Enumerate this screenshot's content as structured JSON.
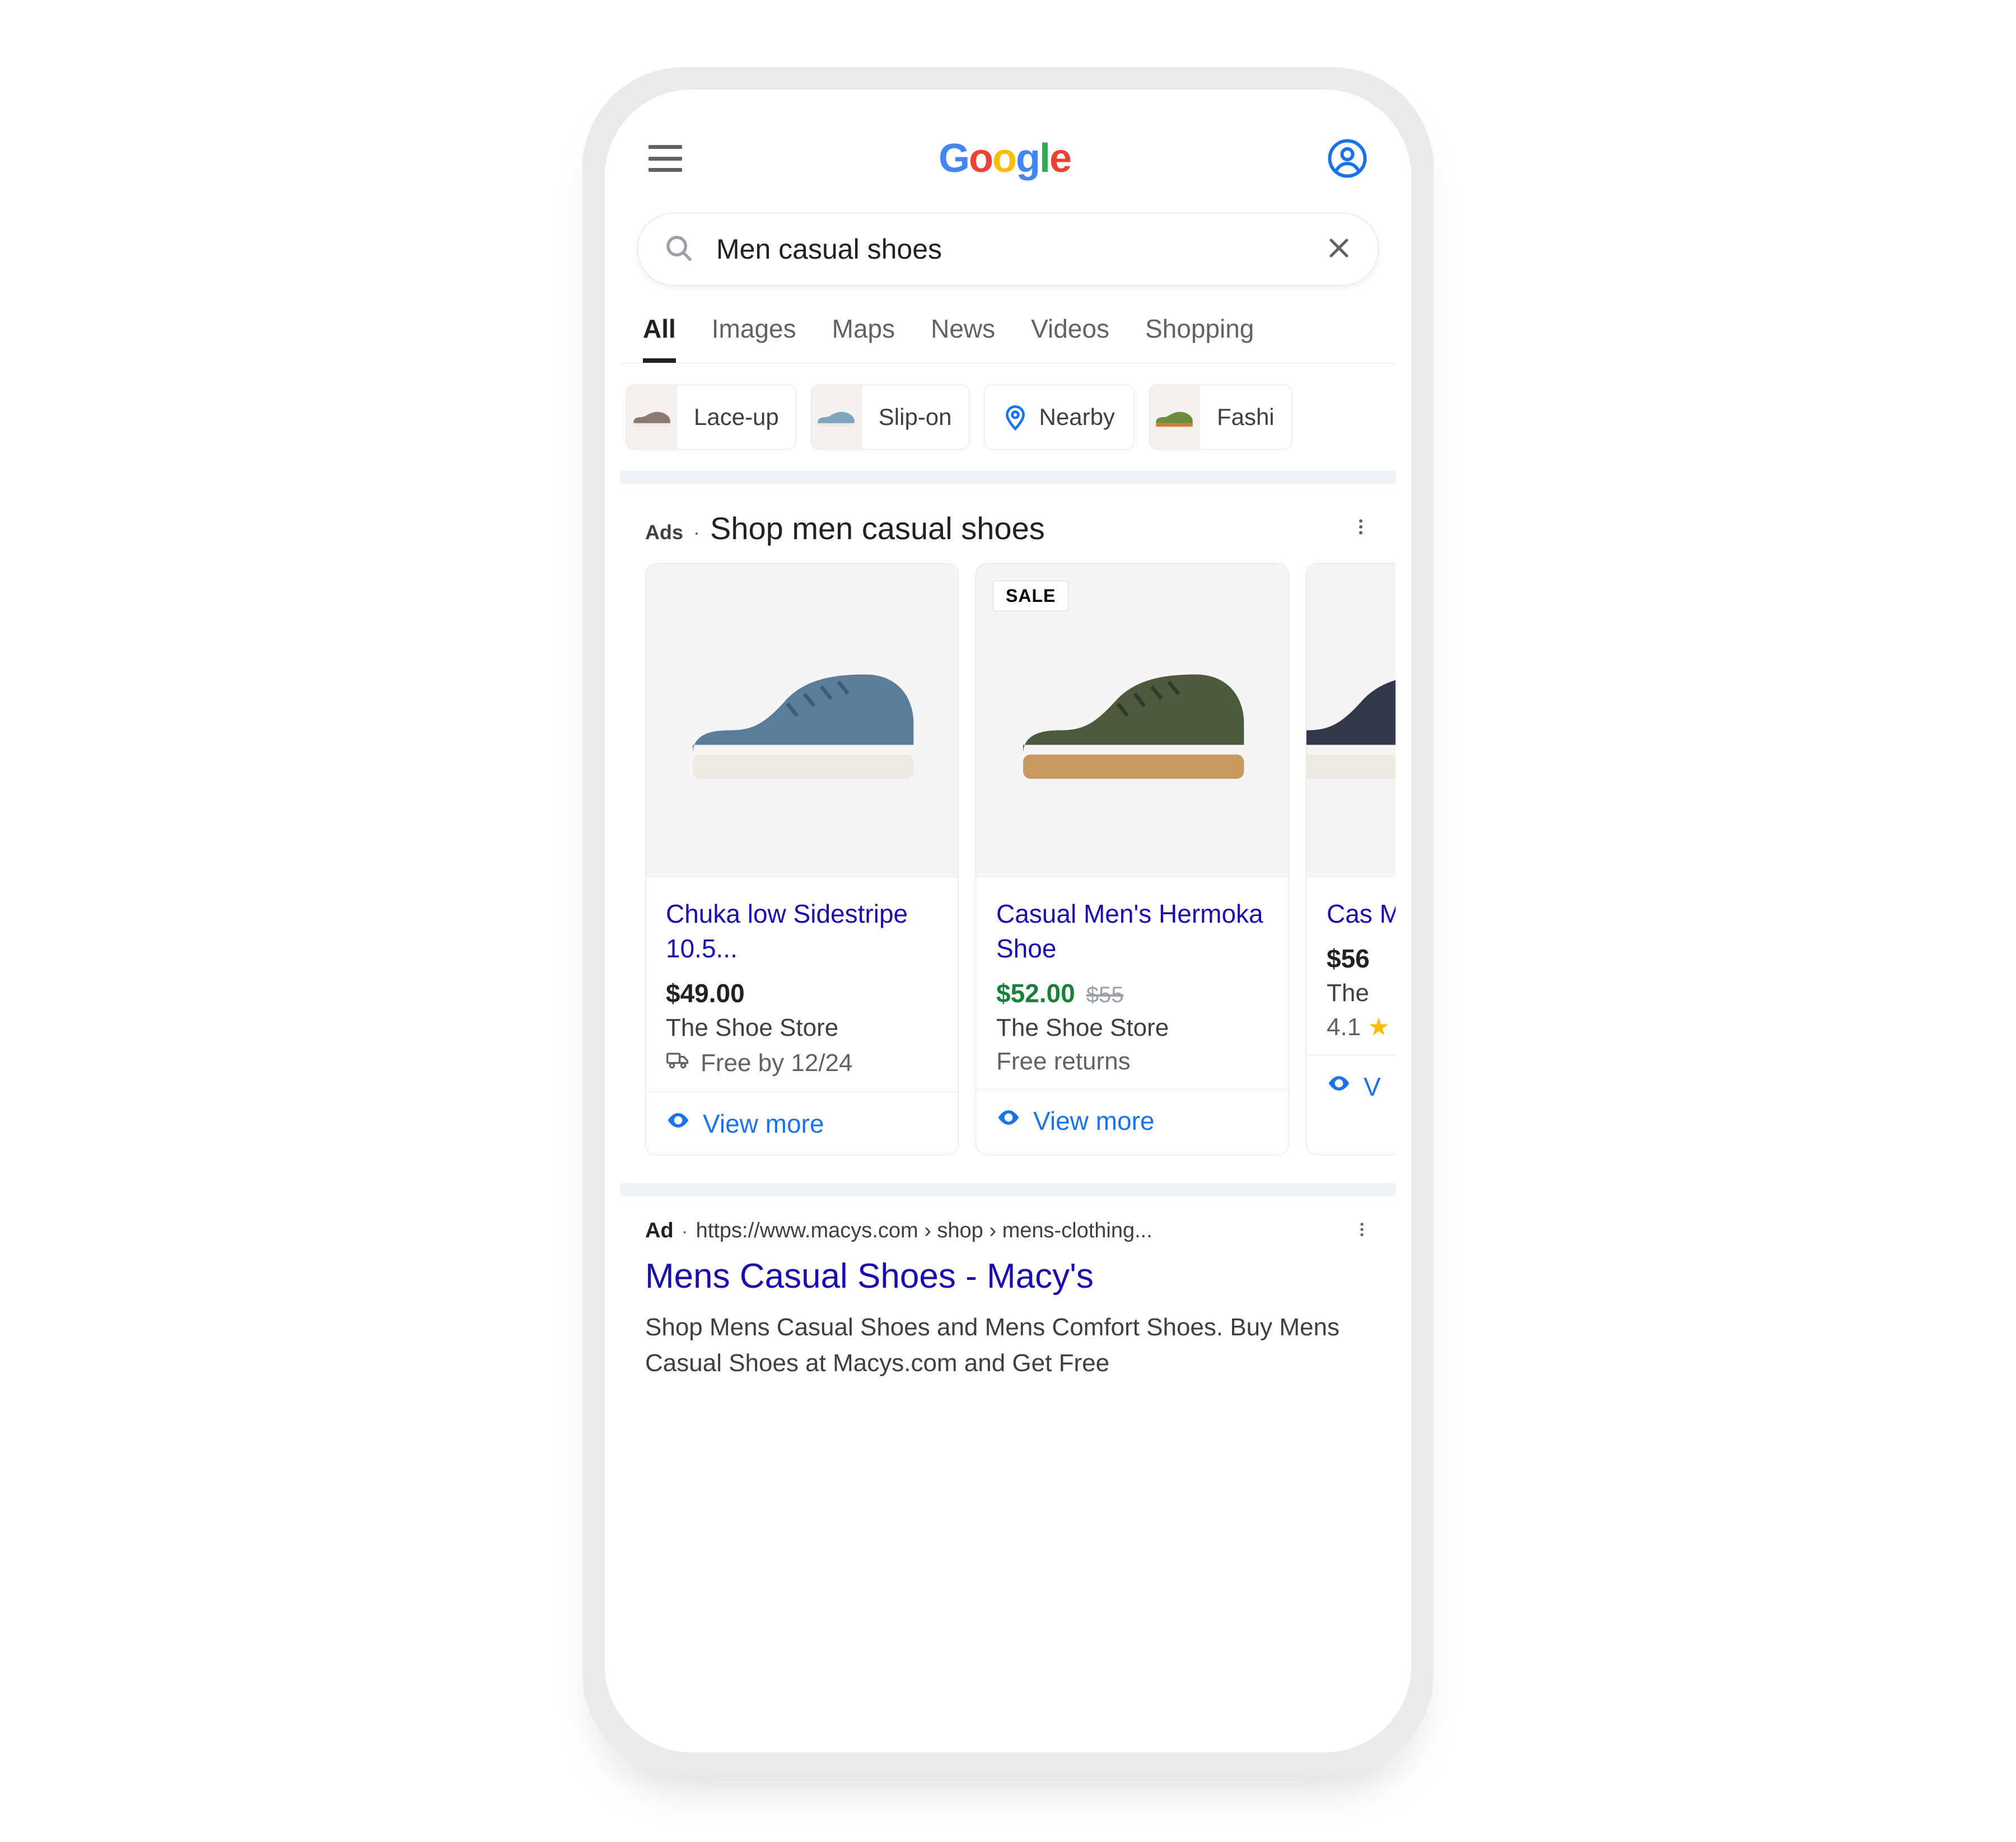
{
  "header": {
    "logo": "Google"
  },
  "search": {
    "query": "Men casual shoes"
  },
  "tabs": [
    "All",
    "Images",
    "Maps",
    "News",
    "Videos",
    "Shopping"
  ],
  "chips": [
    {
      "label": "Lace-up",
      "shoe_color": "#8c7a70"
    },
    {
      "label": "Slip-on",
      "shoe_color": "#7fa5bd"
    },
    {
      "label": "Nearby",
      "nearby": true
    },
    {
      "label": "Fashi",
      "shoe_color": "#6b8e3a"
    }
  ],
  "shopping": {
    "ads_label": "Ads",
    "title": "Shop men casual shoes",
    "cards": [
      {
        "title": "Chuka low Sidestripe 10.5...",
        "price": "$49.00",
        "merchant": "The Shoe Store",
        "shipping": "Free by 12/24",
        "view_more": "View more",
        "shoe_color": "#5c7d99",
        "sole_color": "#eeeae2"
      },
      {
        "badge": "SALE",
        "title": "Casual Men's Hermoka Shoe",
        "price": "$52.00",
        "price_sale": true,
        "price_orig": "$55",
        "merchant": "The Shoe Store",
        "returns": "Free returns",
        "view_more": "View more",
        "shoe_color": "#4d5a3e",
        "sole_color": "#c69a5e"
      },
      {
        "title": "Cas Mer",
        "price": "$56",
        "merchant": "The",
        "rating": "4.1",
        "view_more": "V",
        "shoe_color": "#2f3947",
        "sole_color": "#eeeae2"
      }
    ]
  },
  "text_ad": {
    "badge": "Ad",
    "url": "https://www.macys.com › shop › mens-clothing...",
    "title": "Mens Casual Shoes - Macy's",
    "desc": "Shop Mens Casual Shoes and Mens Comfort Shoes. Buy Mens Casual Shoes at Macys.com and Get Free"
  }
}
